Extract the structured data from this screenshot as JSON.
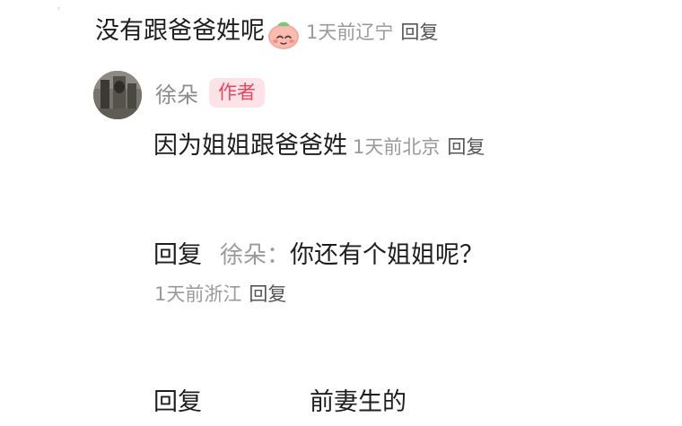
{
  "comment": {
    "text": "没有跟爸爸姓呢",
    "emoji_icon": "piglet-face-emoji",
    "time": "1天前",
    "location": "辽宁",
    "reply_action": "回复"
  },
  "author_reply": {
    "name": "徐朵",
    "badge": "作者",
    "text": "因为姐姐跟爸爸姓",
    "time": "1天前",
    "location": "北京",
    "reply_action": "回复"
  },
  "sub_reply_1": {
    "prefix": "回复",
    "reply_to": "徐朵：",
    "text": "你还有个姐姐呢？",
    "time": "1天前",
    "location": "浙江",
    "reply_action": "回复"
  },
  "sub_reply_2": {
    "prefix": "回复",
    "text": "前妻生的"
  },
  "colors": {
    "badge_bg": "#fde3e8",
    "badge_text": "#e8455f",
    "meta_gray": "#9a9a9a"
  }
}
